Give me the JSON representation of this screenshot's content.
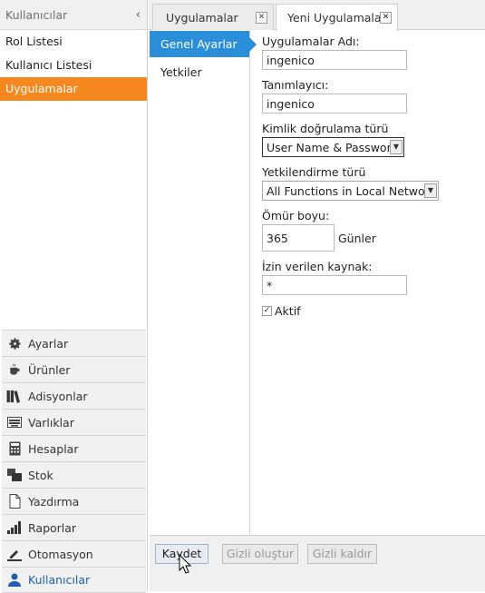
{
  "sidebar": {
    "title": "Kullanıcılar",
    "collapse_icon": "‹",
    "sub_items": [
      {
        "label": "Rol Listesi",
        "active": false
      },
      {
        "label": "Kullanıcı Listesi",
        "active": false
      },
      {
        "label": "Uygulamalar",
        "active": true
      }
    ],
    "nav": [
      {
        "label": "Ayarlar",
        "icon": "gear-icon"
      },
      {
        "label": "Ürünler",
        "icon": "coffee-icon"
      },
      {
        "label": "Adisyonlar",
        "icon": "books-icon"
      },
      {
        "label": "Varlıklar",
        "icon": "keyboard-icon"
      },
      {
        "label": "Hesaplar",
        "icon": "calculator-icon"
      },
      {
        "label": "Stok",
        "icon": "stock-icon"
      },
      {
        "label": "Yazdırma",
        "icon": "document-icon"
      },
      {
        "label": "Raporlar",
        "icon": "bar-chart-icon"
      },
      {
        "label": "Otomasyon",
        "icon": "pen-icon"
      },
      {
        "label": "Kullanıcılar",
        "icon": "user-icon"
      }
    ]
  },
  "tabs": [
    {
      "label": "Uygulamalar",
      "active": false
    },
    {
      "label": "Yeni Uygulamalar Ekle",
      "active": true
    }
  ],
  "subnav": [
    {
      "label": "Genel Ayarlar",
      "active": true
    },
    {
      "label": "Yetkiler",
      "active": false
    }
  ],
  "form": {
    "app_name": {
      "label": "Uygulamalar Adı:",
      "value": "ingenico"
    },
    "identifier": {
      "label": "Tanımlayıcı:",
      "value": "ingenico"
    },
    "auth_type": {
      "label": "Kimlik doğrulama türü",
      "value": "User Name & Password"
    },
    "authorization_type": {
      "label": "Yetkilendirme türü",
      "value": "All Functions in Local Network"
    },
    "lifetime": {
      "label": "Ömür boyu:",
      "value": "365",
      "unit": "Günler"
    },
    "allowed_source": {
      "label": "İzin verilen kaynak:",
      "value": "*"
    },
    "active": {
      "label": "Aktif",
      "checked": true,
      "mark": "✓"
    }
  },
  "actions": {
    "save": "Kaydet",
    "create_secret": "Gizli oluştur",
    "remove_secret": "Gizli kaldır"
  },
  "colors": {
    "active_orange": "#f5891f",
    "active_blue": "#2b8ed8"
  }
}
